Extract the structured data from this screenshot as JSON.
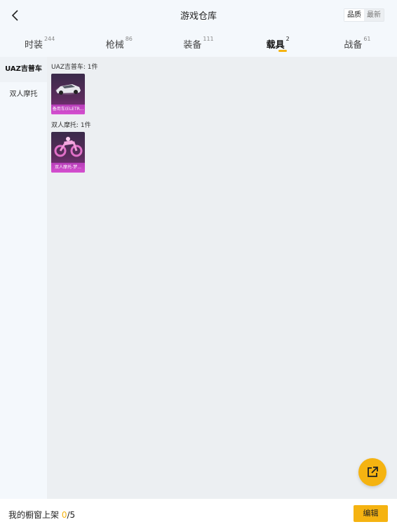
{
  "header": {
    "title": "游戏仓库",
    "sort_options": [
      "品质",
      "最新"
    ],
    "selected_sort": "品质"
  },
  "tabs": [
    {
      "label": "时装",
      "count": "244"
    },
    {
      "label": "枪械",
      "count": "86"
    },
    {
      "label": "装备",
      "count": "111"
    },
    {
      "label": "载具",
      "count": "2"
    },
    {
      "label": "战备",
      "count": "61"
    }
  ],
  "active_tab": "载具",
  "sidebar": {
    "items": [
      {
        "label": "UAZ吉普车"
      },
      {
        "label": "双人摩托"
      }
    ],
    "active": "UAZ吉普车"
  },
  "groups": [
    {
      "label": "UAZ吉普车: 1件",
      "item_caption": "备用车(ELETR..."
    },
    {
      "label": "双人摩托: 1件",
      "item_caption": "双人摩托-梦..."
    }
  ],
  "bottom_bar": {
    "prefix": "我的橱窗上架 ",
    "count": "0",
    "suffix": "/5",
    "edit_label": "编辑"
  },
  "colors": {
    "accent": "#f5b311",
    "card_caption": "#c445c4"
  }
}
